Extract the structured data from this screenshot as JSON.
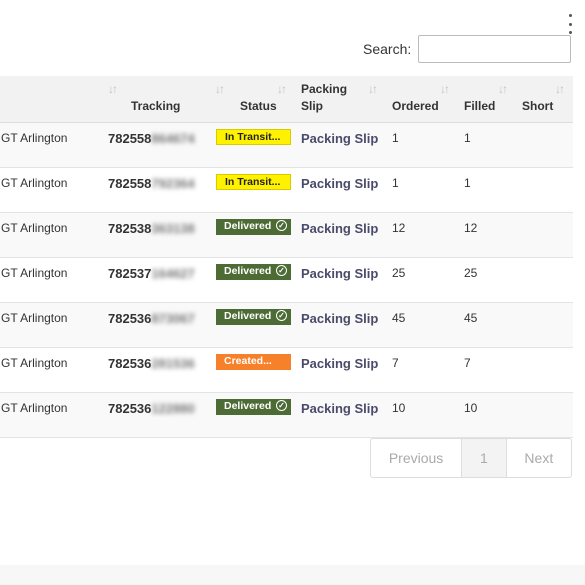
{
  "search": {
    "label": "Search:",
    "value": "",
    "placeholder": ""
  },
  "columns": {
    "tracking": "Tracking",
    "status": "Status",
    "packing_slip_line1": "Packing",
    "packing_slip_line2": "Slip",
    "ordered": "Ordered",
    "filled": "Filled",
    "short": "Short"
  },
  "rows": [
    {
      "location": "GT Arlington",
      "tracking_prefix": "782558",
      "tracking_hidden": "864674",
      "status": "In Transit...",
      "status_type": "transit",
      "packing_slip": "Packing Slip",
      "ordered": "1",
      "filled": "1",
      "short": ""
    },
    {
      "location": "GT Arlington",
      "tracking_prefix": "782558",
      "tracking_hidden": "792364",
      "status": "In Transit...",
      "status_type": "transit",
      "packing_slip": "Packing Slip",
      "ordered": "1",
      "filled": "1",
      "short": ""
    },
    {
      "location": "GT Arlington",
      "tracking_prefix": "782538",
      "tracking_hidden": "363138",
      "status": "Delivered",
      "status_type": "delivered",
      "packing_slip": "Packing Slip",
      "ordered": "12",
      "filled": "12",
      "short": ""
    },
    {
      "location": "GT Arlington",
      "tracking_prefix": "782537",
      "tracking_hidden": "164627",
      "status": "Delivered",
      "status_type": "delivered",
      "packing_slip": "Packing Slip",
      "ordered": "25",
      "filled": "25",
      "short": ""
    },
    {
      "location": "GT Arlington",
      "tracking_prefix": "782536",
      "tracking_hidden": "873067",
      "status": "Delivered",
      "status_type": "delivered",
      "packing_slip": "Packing Slip",
      "ordered": "45",
      "filled": "45",
      "short": ""
    },
    {
      "location": "GT Arlington",
      "tracking_prefix": "782536",
      "tracking_hidden": "281536",
      "status": "Created...",
      "status_type": "created",
      "packing_slip": "Packing Slip",
      "ordered": "7",
      "filled": "7",
      "short": ""
    },
    {
      "location": "GT Arlington",
      "tracking_prefix": "782536",
      "tracking_hidden": "122880",
      "status": "Delivered",
      "status_type": "delivered",
      "packing_slip": "Packing Slip",
      "ordered": "10",
      "filled": "10",
      "short": ""
    }
  ],
  "pagination": {
    "previous": "Previous",
    "current_page": "1",
    "next": "Next"
  },
  "icons": {
    "sort": "sort-arrows-icon",
    "check": "check-circle-icon",
    "menu": "kebab-menu-icon"
  },
  "colors": {
    "transit": "#fff200",
    "delivered": "#4d6b35",
    "created": "#f7802a"
  }
}
